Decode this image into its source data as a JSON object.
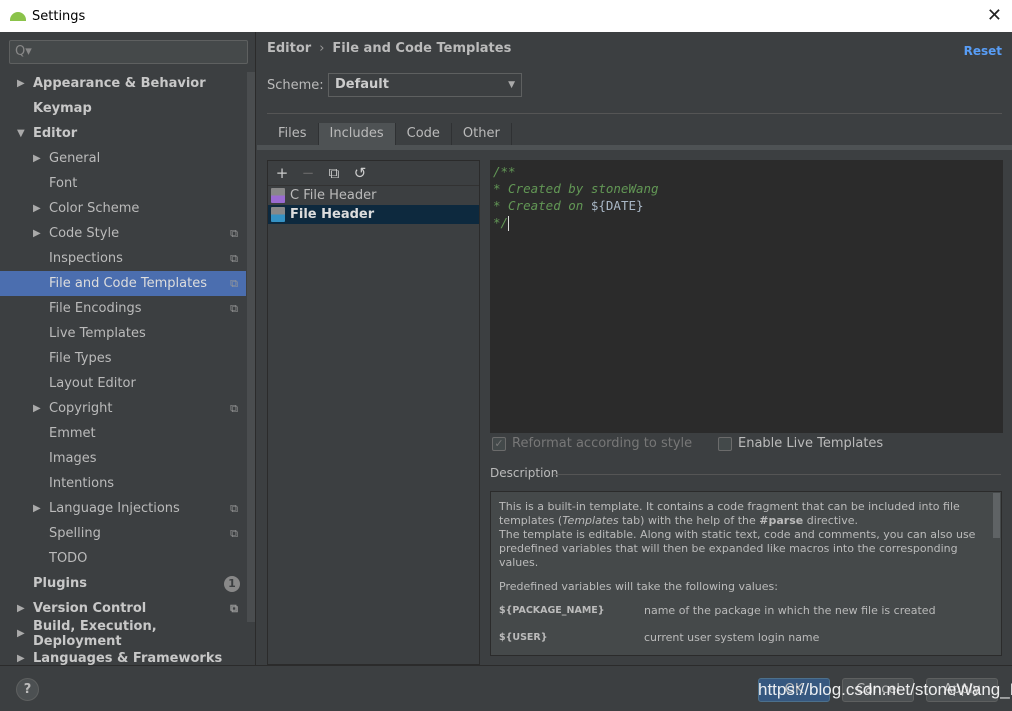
{
  "window": {
    "title": "Settings",
    "close": "✕"
  },
  "search": {
    "placeholder": "Q▾"
  },
  "sidebar": {
    "items": [
      {
        "label": "Appearance & Behavior",
        "level": 0,
        "arrow": "▶",
        "bold": true
      },
      {
        "label": "Keymap",
        "level": 0,
        "bold": true
      },
      {
        "label": "Editor",
        "level": 0,
        "arrow": "▼",
        "bold": true
      },
      {
        "label": "General",
        "level": 1,
        "arrow": "▶"
      },
      {
        "label": "Font",
        "level": 1
      },
      {
        "label": "Color Scheme",
        "level": 1,
        "arrow": "▶"
      },
      {
        "label": "Code Style",
        "level": 1,
        "arrow": "▶",
        "icon": "⧉"
      },
      {
        "label": "Inspections",
        "level": 1,
        "icon": "⧉"
      },
      {
        "label": "File and Code Templates",
        "level": 1,
        "icon": "⧉",
        "selected": true
      },
      {
        "label": "File Encodings",
        "level": 1,
        "icon": "⧉"
      },
      {
        "label": "Live Templates",
        "level": 1
      },
      {
        "label": "File Types",
        "level": 1
      },
      {
        "label": "Layout Editor",
        "level": 1
      },
      {
        "label": "Copyright",
        "level": 1,
        "arrow": "▶",
        "icon": "⧉"
      },
      {
        "label": "Emmet",
        "level": 1
      },
      {
        "label": "Images",
        "level": 1
      },
      {
        "label": "Intentions",
        "level": 1
      },
      {
        "label": "Language Injections",
        "level": 1,
        "arrow": "▶",
        "icon": "⧉"
      },
      {
        "label": "Spelling",
        "level": 1,
        "icon": "⧉"
      },
      {
        "label": "TODO",
        "level": 1
      },
      {
        "label": "Plugins",
        "level": 0,
        "bold": true,
        "badge": "1"
      },
      {
        "label": "Version Control",
        "level": 0,
        "arrow": "▶",
        "bold": true,
        "icon": "⧉"
      },
      {
        "label": "Build, Execution, Deployment",
        "level": 0,
        "arrow": "▶",
        "bold": true
      },
      {
        "label": "Languages & Frameworks",
        "level": 0,
        "arrow": "▶",
        "bold": true
      }
    ]
  },
  "main": {
    "breadcrumb": [
      "Editor",
      "File and Code Templates"
    ],
    "breadcrumb_sep": "›",
    "reset": "Reset",
    "scheme_label": "Scheme:",
    "scheme_value": "Default",
    "tabs": [
      "Files",
      "Includes",
      "Code",
      "Other"
    ],
    "active_tab": "Includes",
    "toolbar": {
      "add": "+",
      "remove": "−",
      "copy": "⧉",
      "reset": "↺"
    },
    "templates": [
      {
        "label": "C File Header",
        "icon": "cpp-file-icon"
      },
      {
        "label": "File Header",
        "icon": "java-file-icon",
        "selected": true
      }
    ],
    "editor": {
      "line1": "/**",
      "line2": "* Created by stoneWang",
      "line3_pre": "* Created on ",
      "line3_var": "${DATE}",
      "line4": "*/"
    },
    "reformat": {
      "label": "Reformat according to style",
      "checked": true,
      "disabled": true
    },
    "live_templates": {
      "label": "Enable Live Templates",
      "checked": false
    },
    "description_label": "Description",
    "description": {
      "p1_a": "This is a built-in template. It contains a code fragment that can be included into file templates (",
      "p1_em": "Templates",
      "p1_b": " tab) with the help of the ",
      "p1_strong": "#parse",
      "p1_c": " directive.",
      "p2": "The template is editable. Along with static text, code and comments, you can also use predefined variables that will then be expanded like macros into the corresponding values.",
      "p3": "Predefined variables will take the following values:",
      "vars": [
        {
          "name": "${PACKAGE_NAME}",
          "desc": "name of the package in which the new file is created"
        },
        {
          "name": "${USER}",
          "desc": "current user system login name"
        }
      ]
    }
  },
  "footer": {
    "help": "?",
    "ok": "OK",
    "cancel": "Cancel",
    "apply": "Apply"
  },
  "watermark": "https://blog.csdn.net/stoneWang_L",
  "colors": {
    "selection": "#4b6eaf",
    "accent": "#589df6",
    "comment": "#629755",
    "ok_button": "#365880"
  }
}
